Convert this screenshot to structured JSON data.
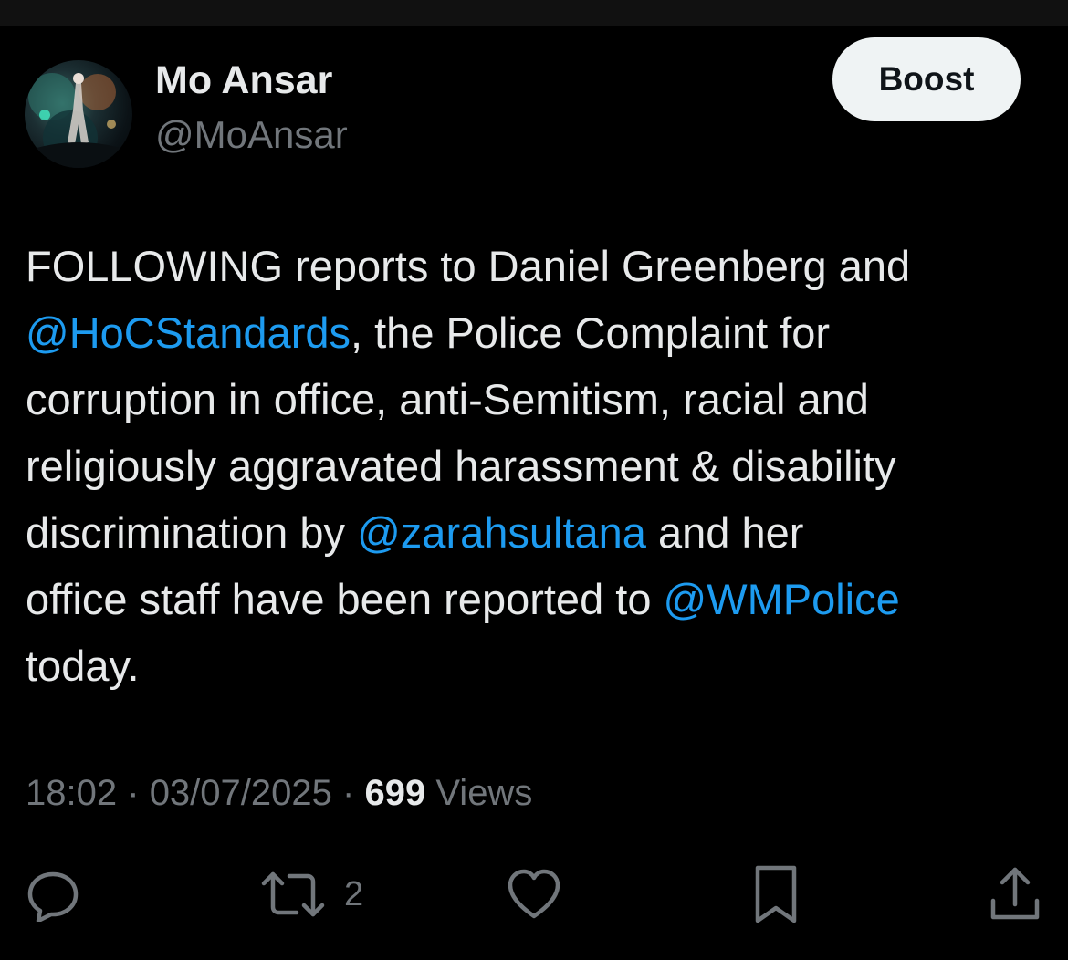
{
  "colors": {
    "background": "#000000",
    "text": "#e7e9ea",
    "secondary": "#71767b",
    "mention": "#1d9bf0",
    "boost_bg": "#eff3f4"
  },
  "author": {
    "display_name": "Mo Ansar",
    "handle": "@MoAnsar",
    "avatar_icon": "avatar-photo"
  },
  "header": {
    "boost_label": "Boost"
  },
  "tweet": {
    "lines": [
      [
        {
          "text": "FOLLOWING reports to Daniel Greenberg and",
          "mention": false
        }
      ],
      [
        {
          "text": "@HoCStandards",
          "mention": true
        },
        {
          "text": ", the Police Complaint for",
          "mention": false
        }
      ],
      [
        {
          "text": "corruption in office, anti-Semitism, racial and",
          "mention": false
        }
      ],
      [
        {
          "text": "religiously aggravated harassment & disability",
          "mention": false
        }
      ],
      [
        {
          "text": "discrimination by ",
          "mention": false
        },
        {
          "text": "@zarahsultana",
          "mention": true
        },
        {
          "text": " and her",
          "mention": false
        }
      ],
      [
        {
          "text": "office staff have been reported to ",
          "mention": false
        },
        {
          "text": "@WMPolice",
          "mention": true
        }
      ],
      [
        {
          "text": "today.",
          "mention": false
        }
      ]
    ]
  },
  "meta": {
    "time": "18:02",
    "separator": "·",
    "date": "03/07/2025",
    "views_count": "699",
    "views_label": "Views"
  },
  "actions": {
    "reply_icon": "reply-icon",
    "retweet_icon": "retweet-icon",
    "retweet_count": "2",
    "like_icon": "heart-icon",
    "bookmark_icon": "bookmark-icon",
    "share_icon": "share-icon"
  }
}
